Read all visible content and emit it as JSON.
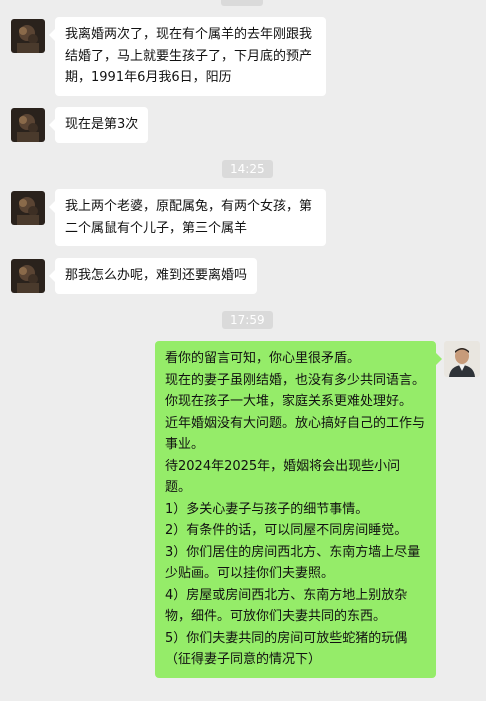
{
  "messages": [
    {
      "text": "我离婚两次了，现在有个属羊的去年刚跟我结婚了，马上就要生孩子了，下月底的预产期，1991年6月我6日，阳历"
    },
    {
      "text": "现在是第3次"
    },
    {
      "time": "14:25"
    },
    {
      "text": "我上两个老婆，原配属兔，有两个女孩，第二个属鼠有个儿子，第三个属羊"
    },
    {
      "text": "那我怎么办呢，难到还要离婚吗"
    },
    {
      "time": "17:59"
    },
    {
      "text": "看你的留言可知，你心里很矛盾。\n现在的妻子虽刚结婚，也没有多少共同语言。\n你现在孩子一大堆，家庭关系更难处理好。\n近年婚姻没有大问题。放心搞好自己的工作与事业。\n待2024年2025年，婚姻将会出现些小问题。\n1）多关心妻子与孩子的细节事情。\n2）有条件的话，可以同屋不同房间睡觉。\n3）你们居住的房间西北方、东南方墙上尽量少贴画。可以挂你们夫妻照。\n4）房屋或房间西北方、东南方地上别放杂物，细件。可放你们夫妻共同的东西。\n5）你们夫妻共同的房间可放些蛇猪的玩偶（征得妻子同意的情况下）"
    }
  ]
}
